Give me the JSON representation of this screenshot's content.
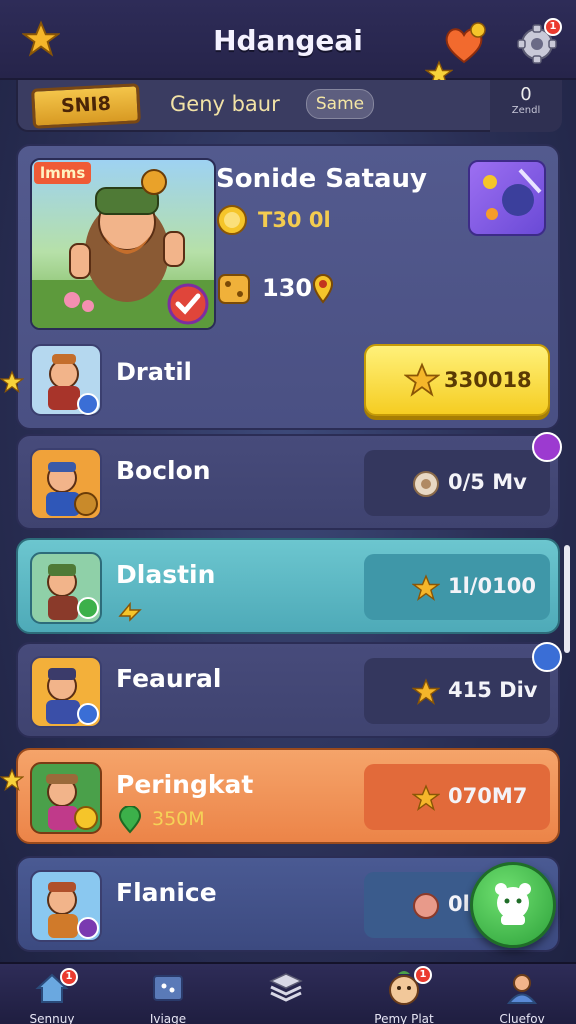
{
  "header": {
    "title": "Hdangeai"
  },
  "search": {
    "banner": "SNI8",
    "text": "Geny baur",
    "chip": "Same",
    "right_num": "0",
    "right_label": "Zendl"
  },
  "featured": {
    "badge": "lmms",
    "name": "Sonide Satauy",
    "coins": "T30 0l",
    "gems": "130",
    "sub_name": "Dratil",
    "button_label": "330018"
  },
  "rows": [
    {
      "name": "Boclon",
      "value": "0/5 Mv",
      "sub": ""
    },
    {
      "name": "Dlastin",
      "value": "1l/0100",
      "sub": ""
    },
    {
      "name": "Feaural",
      "value": "415 Div",
      "sub": ""
    },
    {
      "name": "Peringkat",
      "value": "070M7",
      "sub": "350M"
    },
    {
      "name": "Flanice",
      "value": "0l",
      "sub": ""
    }
  ],
  "nav": [
    {
      "label": "Sennuy",
      "icon": "home-icon"
    },
    {
      "label": "Iviage",
      "icon": "map-icon"
    },
    {
      "label": "",
      "icon": "layers-icon"
    },
    {
      "label": "Pemy Plat",
      "icon": "avatar-icon"
    },
    {
      "label": "Cluefov",
      "icon": "profile-icon"
    }
  ],
  "badges": {
    "nav_home": "1",
    "nav_avatar": "1",
    "gear": "1"
  },
  "colors": {
    "gold": "#f5cd22",
    "teal": "#4eaab8",
    "orange": "#ec8448",
    "green": "#2da13a"
  }
}
